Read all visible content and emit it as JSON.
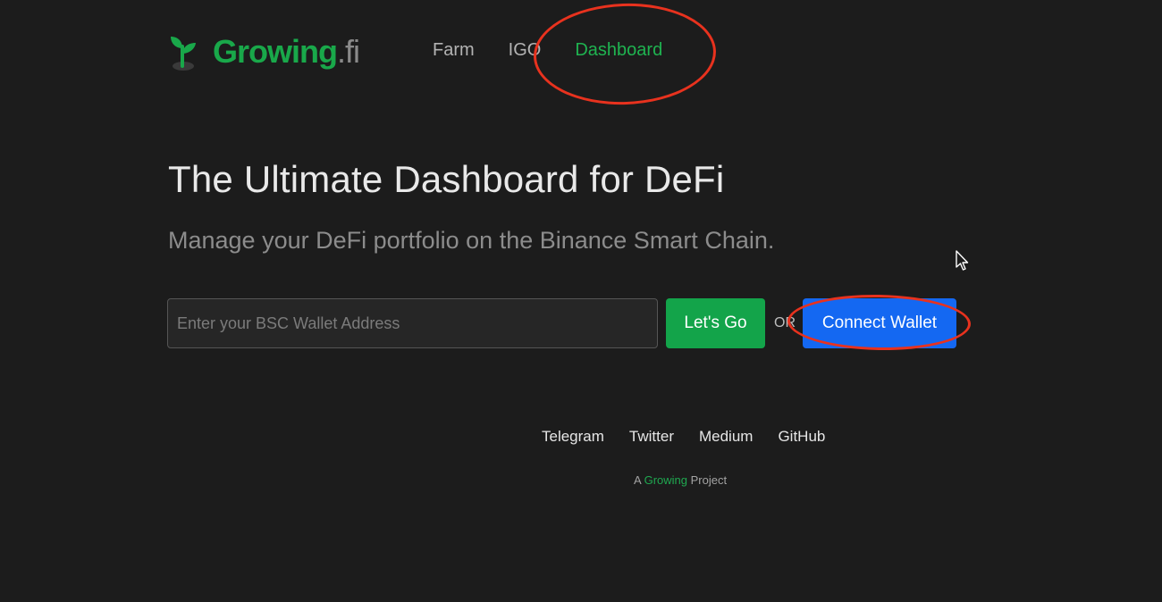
{
  "header": {
    "logo_main": "Growing",
    "logo_tld": ".fi",
    "nav": [
      {
        "label": "Farm",
        "active": false
      },
      {
        "label": "IGO",
        "active": false
      },
      {
        "label": "Dashboard",
        "active": true
      }
    ]
  },
  "hero": {
    "title": "The Ultimate Dashboard for DeFi",
    "subtitle": "Manage your DeFi portfolio on the Binance Smart Chain."
  },
  "form": {
    "wallet_input_placeholder": "Enter your BSC Wallet Address",
    "wallet_input_value": "",
    "go_label": "Let's Go",
    "or_label": "OR",
    "connect_label": "Connect Wallet"
  },
  "footer": {
    "links": [
      "Telegram",
      "Twitter",
      "Medium",
      "GitHub"
    ],
    "credit_prefix": "A",
    "credit_brand": "Growing",
    "credit_suffix": "Project"
  },
  "icons": {
    "logo": "sprout-icon",
    "cursor": "mouse-pointer-icon"
  },
  "colors": {
    "background": "#1c1c1c",
    "brand_green": "#19a84a",
    "go_button": "#13a44a",
    "connect_button": "#1468f2",
    "annotation_red": "#e8321e"
  }
}
